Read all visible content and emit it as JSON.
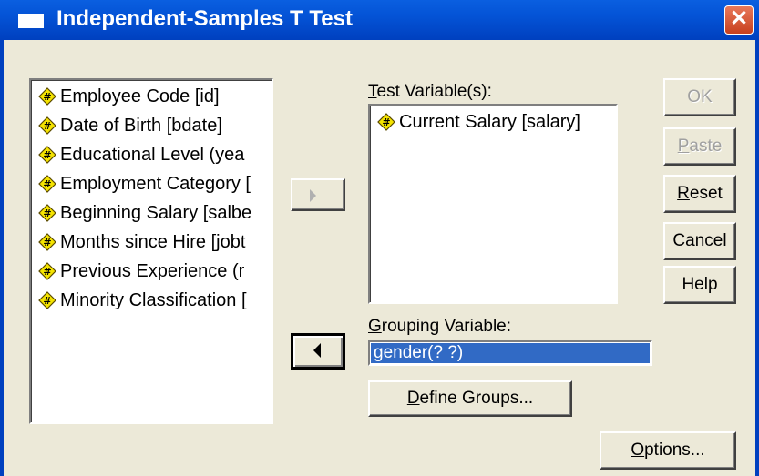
{
  "window": {
    "title": "Independent-Samples T Test",
    "close": "✕"
  },
  "source_list": {
    "items": [
      "Employee Code [id]",
      "Date of Birth [bdate]",
      "Educational Level (yea",
      "Employment Category [",
      "Beginning Salary [salbe",
      "Months since Hire [jobt",
      "Previous Experience (r",
      "Minority Classification ["
    ],
    "item_icon": "scale-variable-icon"
  },
  "test_variables": {
    "label": "Test Variable(s):",
    "items": [
      "Current Salary [salary]"
    ]
  },
  "grouping": {
    "label": "Grouping Variable:",
    "value": "gender(? ?)"
  },
  "buttons": {
    "ok": "OK",
    "paste": "Paste",
    "reset": "Reset",
    "cancel": "Cancel",
    "help": "Help",
    "define_groups": "Define Groups...",
    "options": "Options..."
  },
  "colors": {
    "titlebar": "#0453d6",
    "dialog_bg": "#ece9d8",
    "selection": "#316ac5"
  }
}
